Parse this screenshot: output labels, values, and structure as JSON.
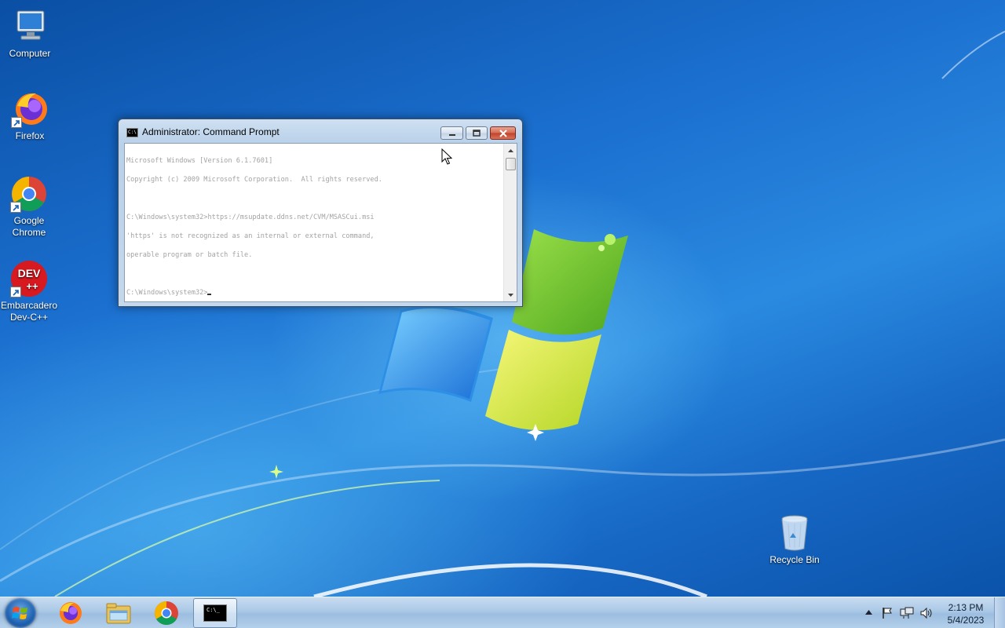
{
  "desktop": {
    "icons": [
      {
        "label": "Computer",
        "icon": "computer-icon"
      },
      {
        "label": "Firefox",
        "icon": "firefox-icon"
      },
      {
        "label": "Google Chrome",
        "icon": "chrome-icon"
      },
      {
        "label": "Embarcadero Dev-C++",
        "icon": "devcpp-icon"
      },
      {
        "label": "Recycle Bin",
        "icon": "recycle-bin-icon"
      }
    ]
  },
  "cmd_window": {
    "title": "Administrator:  Command Prompt",
    "icon_text": "C:\\",
    "lines": [
      "Microsoft Windows [Version 6.1.7601]",
      "Copyright (c) 2009 Microsoft Corporation.  All rights reserved.",
      "",
      "C:\\Windows\\system32>https://msupdate.ddns.net/CVM/MSASCui.msi",
      "'https' is not recognized as an internal or external command,",
      "operable program or batch file.",
      ""
    ],
    "prompt": "C:\\Windows\\system32>",
    "buttons": {
      "minimize": "minimize-icon",
      "maximize": "maximize-icon",
      "close": "close-icon"
    }
  },
  "taskbar": {
    "start": "windows-logo-icon",
    "items": [
      {
        "name": "firefox",
        "icon": "firefox-icon"
      },
      {
        "name": "explorer",
        "icon": "folder-icon"
      },
      {
        "name": "chrome",
        "icon": "chrome-icon"
      },
      {
        "name": "cmd",
        "icon": "cmd-icon",
        "icon_text": "C:\\_",
        "active": true
      }
    ],
    "tray": [
      "show-hidden-icons-arrow",
      "action-center-flag-icon",
      "network-icon",
      "volume-icon"
    ],
    "clock": {
      "time": "2:13 PM",
      "date": "5/4/2023"
    }
  },
  "colors": {
    "desktop_blue": "#1b6fcf",
    "taskbar": "#aac8e6",
    "cmd_text": "#a3a3a3",
    "close_red": "#c0402a"
  }
}
